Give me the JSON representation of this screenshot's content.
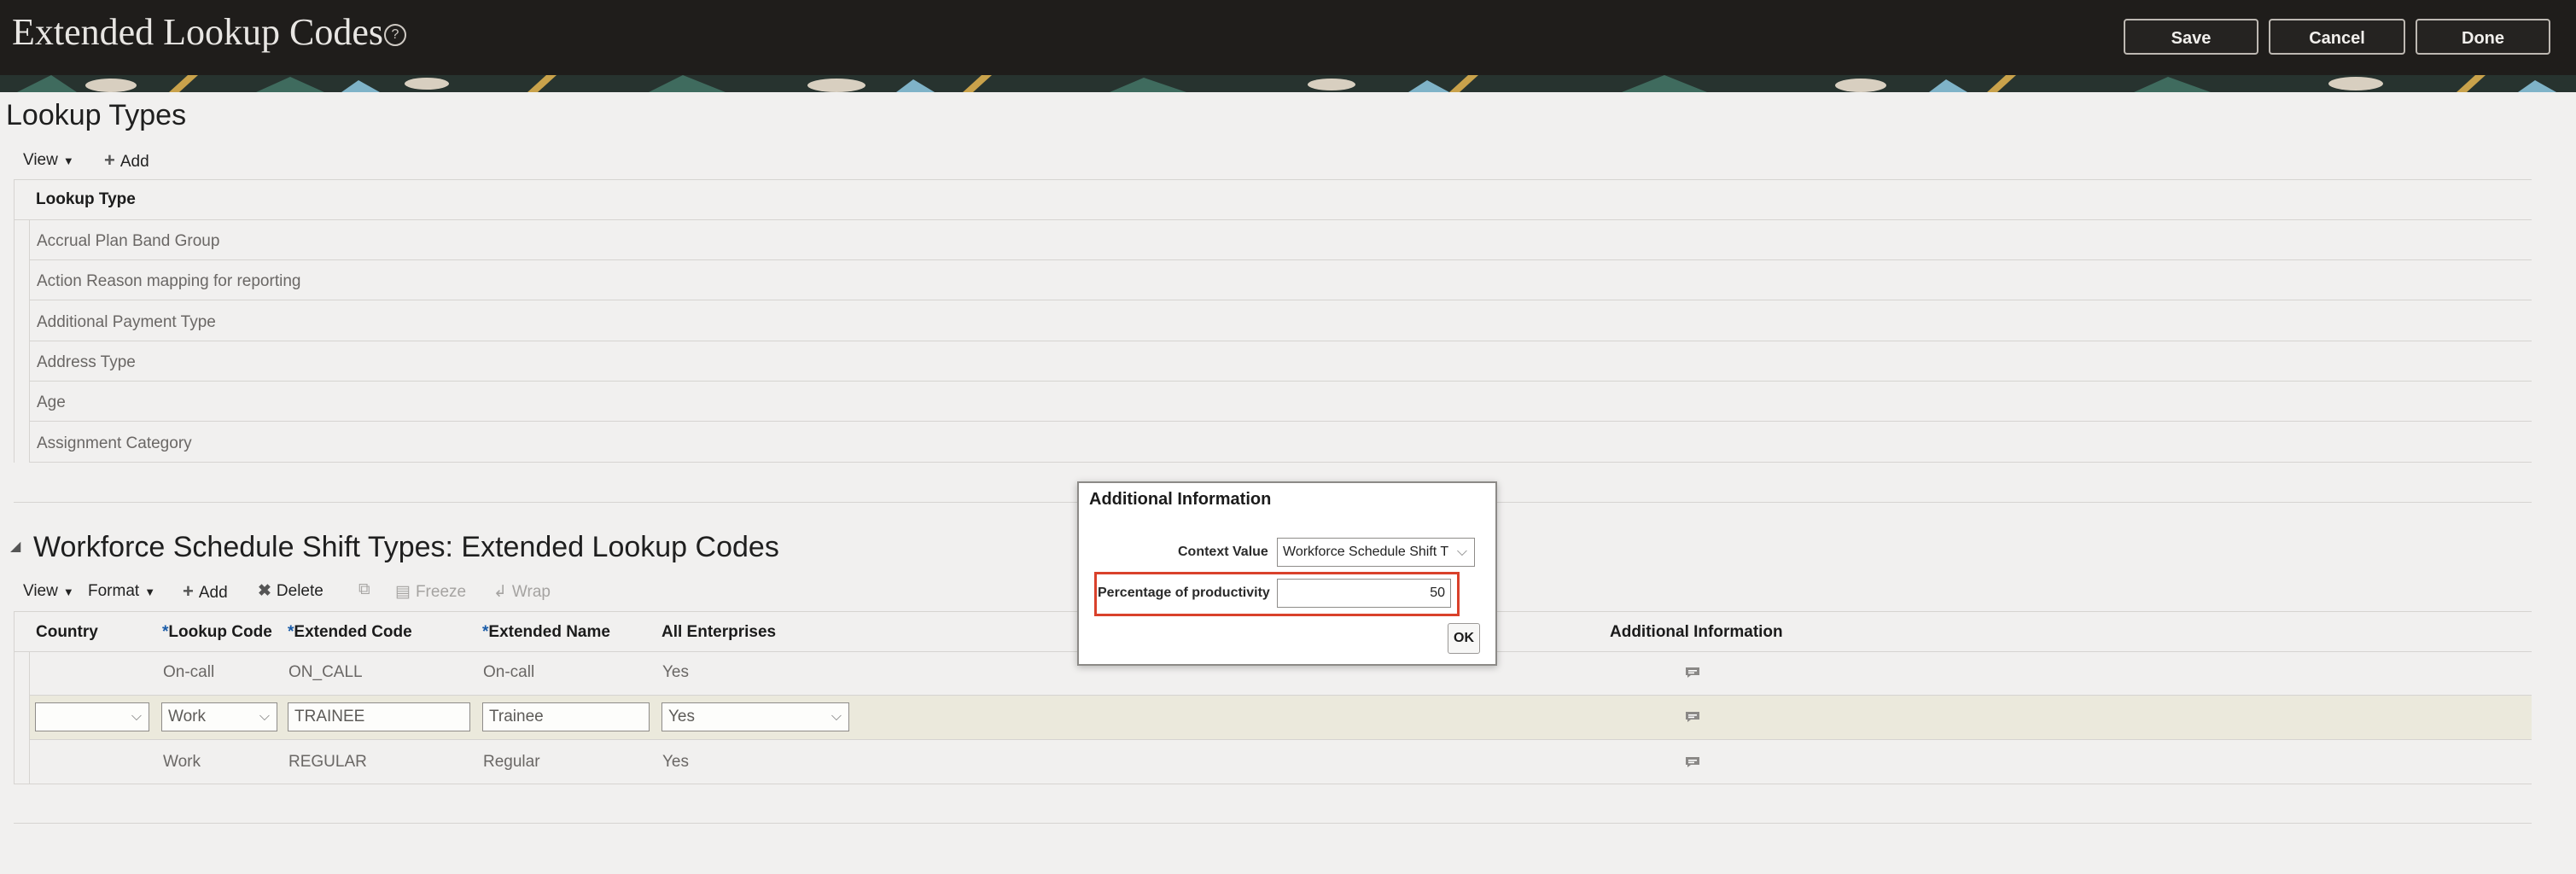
{
  "header": {
    "title": "Extended Lookup Codes",
    "help_icon": "question-circle-icon",
    "buttons": {
      "save": "Save",
      "cancel": "Cancel",
      "done": "Done"
    }
  },
  "lookup_types": {
    "title": "Lookup Types",
    "toolbar": {
      "view": "View",
      "add": "Add"
    },
    "column_header": "Lookup Type",
    "rows": [
      "Accrual Plan Band Group",
      "Action Reason mapping for reporting",
      "Additional Payment Type",
      "Address Type",
      "Age",
      "Assignment Category"
    ]
  },
  "codes": {
    "title": "Workforce Schedule Shift Types: Extended Lookup Codes",
    "toolbar": {
      "view": "View",
      "format": "Format",
      "add": "Add",
      "delete": "Delete",
      "freeze": "Freeze",
      "wrap": "Wrap"
    },
    "columns": {
      "country": "Country",
      "lookup_code": "Lookup Code",
      "extended_code": "Extended Code",
      "extended_name": "Extended Name",
      "all_enterprises": "All Enterprises",
      "additional_information": "Additional Information"
    },
    "required_marker": "*",
    "rows": [
      {
        "country": "",
        "lookup_code": "On-call",
        "extended_code": "ON_CALL",
        "extended_name": "On-call",
        "all_enterprises": "Yes"
      },
      {
        "country": "",
        "lookup_code": "Work",
        "extended_code": "TRAINEE",
        "extended_name": "Trainee",
        "all_enterprises": "Yes"
      },
      {
        "country": "",
        "lookup_code": "Work",
        "extended_code": "REGULAR",
        "extended_name": "Regular",
        "all_enterprises": "Yes"
      }
    ],
    "selected_row_index": 1
  },
  "dialog": {
    "title": "Additional Information",
    "context_label": "Context Value",
    "context_value": "Workforce Schedule Shift T",
    "productivity_label": "Percentage of productivity",
    "productivity_value": "50",
    "ok": "OK"
  },
  "colors": {
    "header_bg": "#1f1d1b",
    "page_bg": "#f1f0ef",
    "selected_row": "#ebe9dc",
    "highlight_border": "#d9412b",
    "required": "#1a5ca8"
  }
}
